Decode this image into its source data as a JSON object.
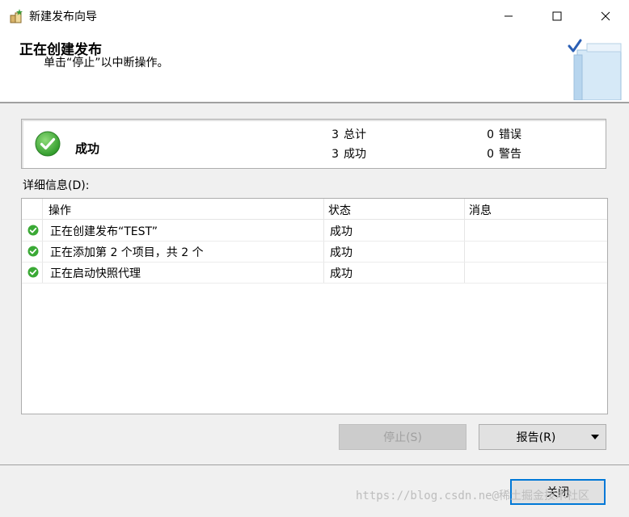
{
  "window": {
    "title": "新建发布向导",
    "minimize_label": "",
    "maximize_label": "",
    "close_label": ""
  },
  "header": {
    "title": "正在创建发布",
    "subtitle": "单击“停止”以中断操作。"
  },
  "status": {
    "icon": "success-check-icon",
    "label": "成功",
    "total_count": "3",
    "total_label": "总计",
    "success_count": "3",
    "success_label": "成功",
    "error_count": "0",
    "error_label": "错误",
    "warning_count": "0",
    "warning_label": "警告"
  },
  "details": {
    "label": "详细信息(D):",
    "columns": [
      "操作",
      "状态",
      "消息"
    ],
    "rows": [
      {
        "action": "正在创建发布“TEST”",
        "status": "成功",
        "message": ""
      },
      {
        "action": "正在添加第 2 个项目，共 2 个",
        "status": "成功",
        "message": ""
      },
      {
        "action": "正在启动快照代理",
        "status": "成功",
        "message": ""
      }
    ]
  },
  "buttons": {
    "stop": "停止(S)",
    "report": "报告(R)",
    "close": "关闭"
  },
  "watermark": "https://blog.csdn.ne@稀土掘金技术社区",
  "colors": {
    "success_green": "#3aa935",
    "focus_blue": "#0078d7"
  }
}
